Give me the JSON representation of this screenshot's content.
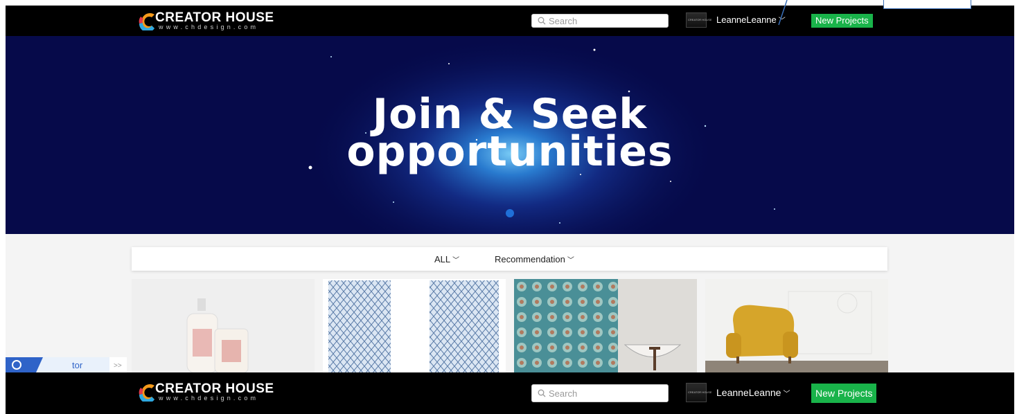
{
  "brand": {
    "name": "CREATOR HOUSE",
    "url_text": "www.chdesign.com"
  },
  "navbar": {
    "search_placeholder": "Search",
    "avatar_text": "CREATOR HOUSE",
    "username": "LeanneLeanne",
    "new_projects_label": "New Projects"
  },
  "hero": {
    "line1": "Join & Seek",
    "line2": "opportunities"
  },
  "filters": {
    "all_label": "ALL",
    "recommendation_label": "Recommendation"
  },
  "cards": [
    {
      "subject": "lotion-bottle-and-candle-product"
    },
    {
      "subject": "blue-geometric-curtains"
    },
    {
      "subject": "turquoise-patterned-curtain-bathroom"
    },
    {
      "subject": "yellow-patterned-armchair"
    }
  ],
  "widget": {
    "text": "tor",
    "expand_glyph": ">>"
  },
  "colors": {
    "navbar_bg": "#000000",
    "hero_bg": "#060a4a",
    "accent_green": "#19b34a",
    "page_bg": "#f4f4f4"
  }
}
